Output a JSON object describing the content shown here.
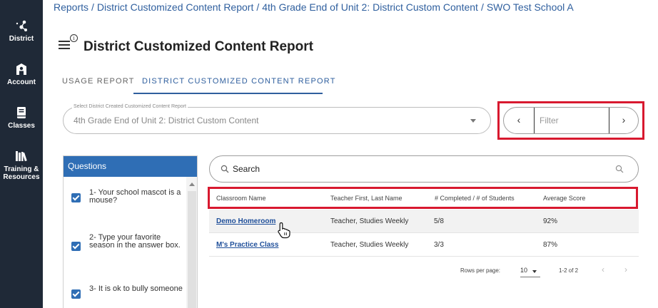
{
  "sidebar": {
    "items": [
      {
        "label": "District",
        "icon": "district-icon"
      },
      {
        "label": "Account",
        "icon": "account-icon"
      },
      {
        "label": "Classes",
        "icon": "classes-icon"
      },
      {
        "label": "Training & Resources",
        "icon": "books-icon"
      }
    ]
  },
  "breadcrumb": {
    "items": [
      "Reports",
      "District Customized Content Report",
      "4th Grade End of Unit 2: District Custom Content",
      "SWO Test School A"
    ],
    "separator": "/"
  },
  "header": {
    "title": "District Customized Content Report",
    "info_glyph": "i"
  },
  "tabs": [
    {
      "label": "USAGE REPORT",
      "active": false
    },
    {
      "label": "DISTRICT CUSTOMIZED CONTENT REPORT",
      "active": true
    }
  ],
  "report_select": {
    "label": "Select District Created Customized Content Report",
    "value": "4th Grade End of Unit 2: District Custom Content"
  },
  "filter": {
    "placeholder": "Filter",
    "prev_glyph": "‹",
    "next_glyph": "›"
  },
  "questions": {
    "title": "Questions",
    "items": [
      {
        "text": "1- Your school mascot is a mouse?",
        "checked": true
      },
      {
        "text": "2- Type your favorite season in the answer box.",
        "checked": true
      },
      {
        "text": "3- It is ok to bully someone",
        "checked": true
      }
    ]
  },
  "search": {
    "placeholder": "Search"
  },
  "table": {
    "columns": [
      "Classroom Name",
      "Teacher First, Last Name",
      "# Completed / # of Students",
      "Average Score"
    ],
    "rows": [
      {
        "classroom": "Demo Homeroom",
        "teacher": "Teacher, Studies Weekly",
        "completed": "5/8",
        "score": "92%"
      },
      {
        "classroom": "M's Practice Class",
        "teacher": "Teacher, Studies Weekly",
        "completed": "3/3",
        "score": "87%"
      }
    ]
  },
  "pagination": {
    "rows_per_page_label": "Rows per page:",
    "rows_per_page": "10",
    "range": "1-2 of 2",
    "prev_glyph": "‹",
    "next_glyph": "›"
  },
  "colors": {
    "sidebar_bg": "#1f2937",
    "accent": "#2f6eb5",
    "link": "#1f4f9a",
    "highlight": "#d8192f"
  }
}
